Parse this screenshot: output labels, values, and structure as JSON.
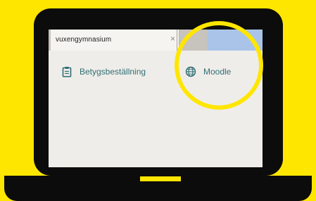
{
  "browser": {
    "tab_title": "vuxengymnasium",
    "tab_close_glyph": "×"
  },
  "links": {
    "betyg_label": "Betygsbeställning",
    "betyg_icon": "clipboard-icon",
    "moodle_label": "Moodle",
    "moodle_icon": "globe-icon"
  },
  "colors": {
    "background": "#ffe600",
    "laptop": "#0c0c0c",
    "link_text": "#2f6f73",
    "highlight": "#ffe600"
  }
}
